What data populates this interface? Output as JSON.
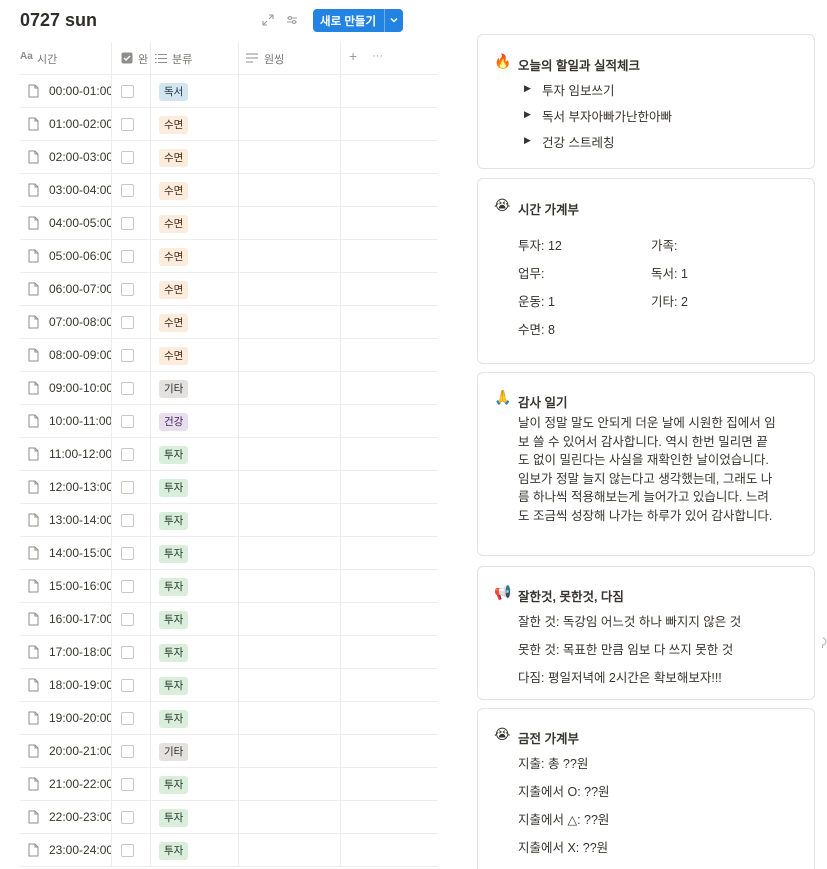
{
  "database": {
    "title": "0727 sun",
    "new_button_label": "새로 만들기",
    "columns": {
      "name_icon": "Aa",
      "name": "시간",
      "check": "완료",
      "category": "분류",
      "note": "원씽",
      "add": "+",
      "more": "···"
    },
    "rows": [
      {
        "time": "00:00-01:00",
        "tag": "독서"
      },
      {
        "time": "01:00-02:00",
        "tag": "수면"
      },
      {
        "time": "02:00-03:00",
        "tag": "수면"
      },
      {
        "time": "03:00-04:00",
        "tag": "수면"
      },
      {
        "time": "04:00-05:00",
        "tag": "수면"
      },
      {
        "time": "05:00-06:00",
        "tag": "수면"
      },
      {
        "time": "06:00-07:00",
        "tag": "수면"
      },
      {
        "time": "07:00-08:00",
        "tag": "수면"
      },
      {
        "time": "08:00-09:00",
        "tag": "수면"
      },
      {
        "time": "09:00-10:00",
        "tag": "기타"
      },
      {
        "time": "10:00-11:00",
        "tag": "건강"
      },
      {
        "time": "11:00-12:00",
        "tag": "투자"
      },
      {
        "time": "12:00-13:00",
        "tag": "투자"
      },
      {
        "time": "13:00-14:00",
        "tag": "투자"
      },
      {
        "time": "14:00-15:00",
        "tag": "투자"
      },
      {
        "time": "15:00-16:00",
        "tag": "투자"
      },
      {
        "time": "16:00-17:00",
        "tag": "투자"
      },
      {
        "time": "17:00-18:00",
        "tag": "투자"
      },
      {
        "time": "18:00-19:00",
        "tag": "투자"
      },
      {
        "time": "19:00-20:00",
        "tag": "투자"
      },
      {
        "time": "20:00-21:00",
        "tag": "기타"
      },
      {
        "time": "21:00-22:00",
        "tag": "투자"
      },
      {
        "time": "22:00-23:00",
        "tag": "투자"
      },
      {
        "time": "23:00-24:00",
        "tag": "투자"
      }
    ]
  },
  "tag_colors": {
    "독서": {
      "bg": "#d3e5ef",
      "fg": "#183347"
    },
    "수면": {
      "bg": "#fbecdd",
      "fg": "#49290e"
    },
    "기타": {
      "bg": "#e3e2e0",
      "fg": "#32302c"
    },
    "건강": {
      "bg": "#e8deee",
      "fg": "#412454"
    },
    "투자": {
      "bg": "#dbeddb",
      "fg": "#1c3829"
    }
  },
  "todo_check": {
    "emoji": "🔥",
    "title": "오늘의 할일과 실적체크",
    "items": [
      "투자 임보쓰기",
      "독서 부자아빠가난한아빠",
      "건강 스트레칭"
    ]
  },
  "time_ledger": {
    "emoji": "😭",
    "title": "시간 가계부",
    "left": [
      "투자: 12",
      "업무:",
      "운동: 1",
      "수면: 8"
    ],
    "right": [
      "가족:",
      "독서: 1",
      "기타: 2"
    ]
  },
  "gratitude": {
    "emoji": "🙏",
    "title": "감사 일기",
    "lines": [
      "날이 정말 말도 안되게 더운 날에 시원한 집에서 임",
      "보 쓸 수 있어서 감사합니다. 역시 한번 밀리면 끝",
      "도 없이 밀린다는 사실을 재확인한 날이었습니다.",
      "임보가 정말 늘지 않는다고 생각했는데, 그래도 나",
      "름 하나씩 적용해보는게 늘어가고 있습니다. 느려",
      "도 조금씩 성장해 나가는 하루가 있어 감사합니다."
    ]
  },
  "reflection": {
    "emoji": "📢",
    "title": "잘한것, 못한것, 다짐",
    "lines": [
      "잘한 것: 독강임 어느것 하나 빠지지 않은 것",
      "못한 것: 목표한 만큼 임보 다 쓰지 못한 것",
      "다짐: 평일저녁에 2시간은 확보해보자!!!"
    ]
  },
  "money_ledger": {
    "emoji": "😭",
    "title": "금전 가계부",
    "lines": [
      "지출: 총 ??원",
      "지출에서 O: ??원",
      "지출에서 △: ??원",
      "지출에서 X: ??원"
    ]
  }
}
